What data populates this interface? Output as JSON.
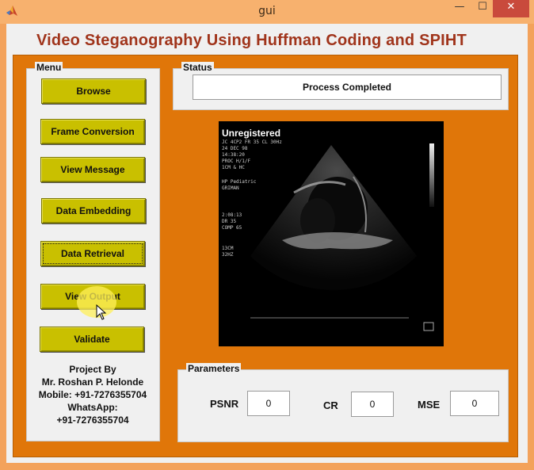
{
  "window": {
    "title": "gui",
    "minimize_glyph": "—",
    "maximize_glyph": "☐",
    "close_glyph": "✕"
  },
  "header": {
    "title": "Video Steganography Using Huffman Coding and SPIHT"
  },
  "menu": {
    "label": "Menu",
    "buttons": [
      {
        "label": "Browse"
      },
      {
        "label": "Frame Conversion"
      },
      {
        "label": "View Message"
      },
      {
        "label": "Data Embedding"
      },
      {
        "label": "Data Retrieval"
      },
      {
        "label": "View Output"
      },
      {
        "label": "Validate"
      }
    ]
  },
  "credits": {
    "line1": "Project By",
    "line2": "Mr. Roshan P. Helonde",
    "line3": "Mobile: +91-7276355704",
    "line4": "WhatsApp:",
    "line5": "+91-7276355704"
  },
  "status": {
    "label": "Status",
    "text": "Process Completed"
  },
  "image": {
    "watermark": "Unregistered",
    "overlay_lines": [
      "JC 4CP2 FR 35 CL 30Hz",
      "24 DEC 98",
      "14:38:20",
      "PROC H/1/F",
      "1CM & HC",
      "HP Pediatric",
      "GRIMAN",
      "2:08:13",
      "DR 35",
      "COMP 65",
      "13CM",
      "32HZ"
    ]
  },
  "parameters": {
    "label": "Parameters",
    "psnr_label": "PSNR",
    "psnr_value": "0",
    "cr_label": "CR",
    "cr_value": "0",
    "mse_label": "MSE",
    "mse_value": "0"
  },
  "colors": {
    "accent_orange": "#e07609",
    "button_olive": "#c9c000",
    "title_red": "#a0341b",
    "close_red": "#c94a3c"
  }
}
